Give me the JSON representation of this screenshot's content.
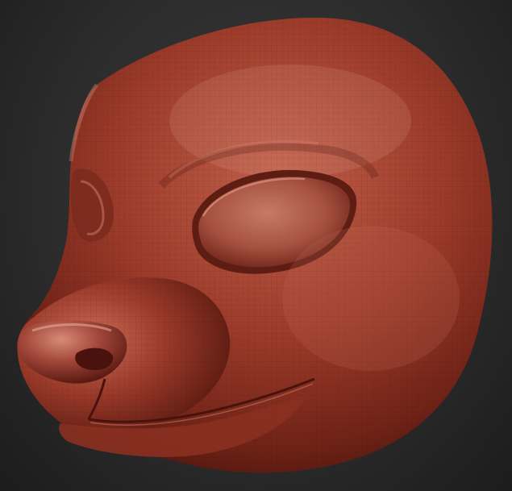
{
  "scene": {
    "subject": "sculpted-animal-head-mask",
    "material_color": "#9c3a2a",
    "highlight_color": "#d98a76",
    "shadow_color": "#4a150d",
    "background_color": "#2c2c2c"
  }
}
